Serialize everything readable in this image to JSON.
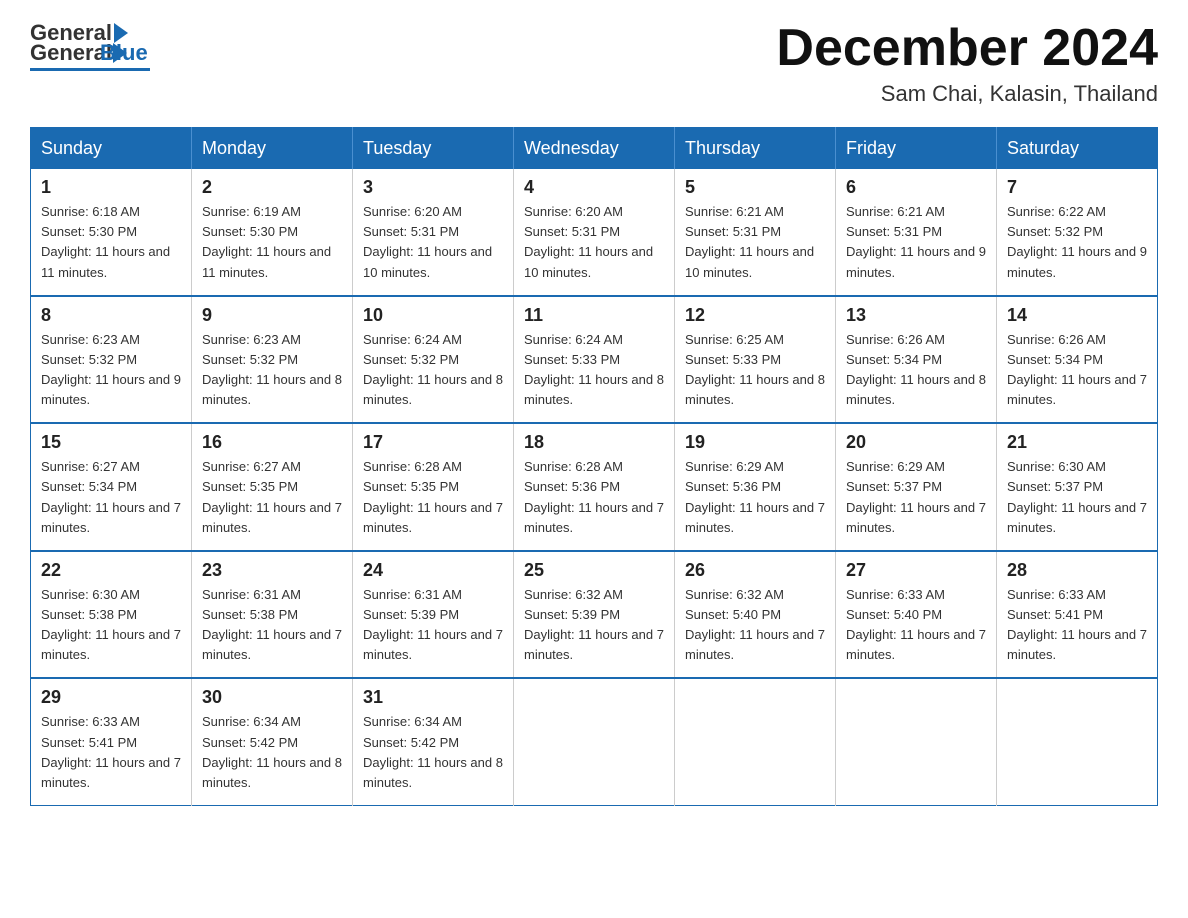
{
  "header": {
    "logo": {
      "general": "General",
      "blue": "Blue"
    },
    "title": "December 2024",
    "location": "Sam Chai, Kalasin, Thailand"
  },
  "calendar": {
    "days_of_week": [
      "Sunday",
      "Monday",
      "Tuesday",
      "Wednesday",
      "Thursday",
      "Friday",
      "Saturday"
    ],
    "weeks": [
      [
        {
          "day": "1",
          "sunrise": "6:18 AM",
          "sunset": "5:30 PM",
          "daylight": "11 hours and 11 minutes."
        },
        {
          "day": "2",
          "sunrise": "6:19 AM",
          "sunset": "5:30 PM",
          "daylight": "11 hours and 11 minutes."
        },
        {
          "day": "3",
          "sunrise": "6:20 AM",
          "sunset": "5:31 PM",
          "daylight": "11 hours and 10 minutes."
        },
        {
          "day": "4",
          "sunrise": "6:20 AM",
          "sunset": "5:31 PM",
          "daylight": "11 hours and 10 minutes."
        },
        {
          "day": "5",
          "sunrise": "6:21 AM",
          "sunset": "5:31 PM",
          "daylight": "11 hours and 10 minutes."
        },
        {
          "day": "6",
          "sunrise": "6:21 AM",
          "sunset": "5:31 PM",
          "daylight": "11 hours and 9 minutes."
        },
        {
          "day": "7",
          "sunrise": "6:22 AM",
          "sunset": "5:32 PM",
          "daylight": "11 hours and 9 minutes."
        }
      ],
      [
        {
          "day": "8",
          "sunrise": "6:23 AM",
          "sunset": "5:32 PM",
          "daylight": "11 hours and 9 minutes."
        },
        {
          "day": "9",
          "sunrise": "6:23 AM",
          "sunset": "5:32 PM",
          "daylight": "11 hours and 8 minutes."
        },
        {
          "day": "10",
          "sunrise": "6:24 AM",
          "sunset": "5:32 PM",
          "daylight": "11 hours and 8 minutes."
        },
        {
          "day": "11",
          "sunrise": "6:24 AM",
          "sunset": "5:33 PM",
          "daylight": "11 hours and 8 minutes."
        },
        {
          "day": "12",
          "sunrise": "6:25 AM",
          "sunset": "5:33 PM",
          "daylight": "11 hours and 8 minutes."
        },
        {
          "day": "13",
          "sunrise": "6:26 AM",
          "sunset": "5:34 PM",
          "daylight": "11 hours and 8 minutes."
        },
        {
          "day": "14",
          "sunrise": "6:26 AM",
          "sunset": "5:34 PM",
          "daylight": "11 hours and 7 minutes."
        }
      ],
      [
        {
          "day": "15",
          "sunrise": "6:27 AM",
          "sunset": "5:34 PM",
          "daylight": "11 hours and 7 minutes."
        },
        {
          "day": "16",
          "sunrise": "6:27 AM",
          "sunset": "5:35 PM",
          "daylight": "11 hours and 7 minutes."
        },
        {
          "day": "17",
          "sunrise": "6:28 AM",
          "sunset": "5:35 PM",
          "daylight": "11 hours and 7 minutes."
        },
        {
          "day": "18",
          "sunrise": "6:28 AM",
          "sunset": "5:36 PM",
          "daylight": "11 hours and 7 minutes."
        },
        {
          "day": "19",
          "sunrise": "6:29 AM",
          "sunset": "5:36 PM",
          "daylight": "11 hours and 7 minutes."
        },
        {
          "day": "20",
          "sunrise": "6:29 AM",
          "sunset": "5:37 PM",
          "daylight": "11 hours and 7 minutes."
        },
        {
          "day": "21",
          "sunrise": "6:30 AM",
          "sunset": "5:37 PM",
          "daylight": "11 hours and 7 minutes."
        }
      ],
      [
        {
          "day": "22",
          "sunrise": "6:30 AM",
          "sunset": "5:38 PM",
          "daylight": "11 hours and 7 minutes."
        },
        {
          "day": "23",
          "sunrise": "6:31 AM",
          "sunset": "5:38 PM",
          "daylight": "11 hours and 7 minutes."
        },
        {
          "day": "24",
          "sunrise": "6:31 AM",
          "sunset": "5:39 PM",
          "daylight": "11 hours and 7 minutes."
        },
        {
          "day": "25",
          "sunrise": "6:32 AM",
          "sunset": "5:39 PM",
          "daylight": "11 hours and 7 minutes."
        },
        {
          "day": "26",
          "sunrise": "6:32 AM",
          "sunset": "5:40 PM",
          "daylight": "11 hours and 7 minutes."
        },
        {
          "day": "27",
          "sunrise": "6:33 AM",
          "sunset": "5:40 PM",
          "daylight": "11 hours and 7 minutes."
        },
        {
          "day": "28",
          "sunrise": "6:33 AM",
          "sunset": "5:41 PM",
          "daylight": "11 hours and 7 minutes."
        }
      ],
      [
        {
          "day": "29",
          "sunrise": "6:33 AM",
          "sunset": "5:41 PM",
          "daylight": "11 hours and 7 minutes."
        },
        {
          "day": "30",
          "sunrise": "6:34 AM",
          "sunset": "5:42 PM",
          "daylight": "11 hours and 8 minutes."
        },
        {
          "day": "31",
          "sunrise": "6:34 AM",
          "sunset": "5:42 PM",
          "daylight": "11 hours and 8 minutes."
        },
        null,
        null,
        null,
        null
      ]
    ]
  }
}
